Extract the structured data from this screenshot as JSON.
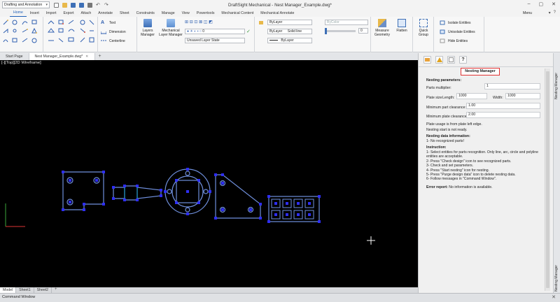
{
  "titlebar": {
    "workspace": "Drafting and Annotation",
    "app_title": "DraftSight Mechanical - Nest Manager_Example.dwg*"
  },
  "menu": {
    "tabs": [
      "Home",
      "Insert",
      "Import",
      "Export",
      "Attach",
      "Annotate",
      "Sheet",
      "Constraints",
      "Manage",
      "View",
      "Powertools",
      "Mechanical Content",
      "Mechanical Annotate"
    ],
    "right_label": "Menu"
  },
  "ribbon": {
    "groups": {
      "quick_group": "Quick Group"
    },
    "annotations": {
      "text": "Text",
      "dimension": "Dimension",
      "centerline": "Centerline"
    },
    "layers": {
      "layers_manager": "Layers Manager",
      "mech_layer_manager": "Mechanical Layer Manager",
      "layer_state": "Unsaved Layer State",
      "current_layer": "0"
    },
    "properties": {
      "color": "ByLayer",
      "linetype": "ByLayer",
      "linetype_desc": "Solid line",
      "lineweight": "ByLayer",
      "plot_style": "ByColor",
      "transparency": "0"
    },
    "tools": {
      "measure": "Measure Geometry",
      "flatten": "Flatten"
    },
    "focus": {
      "isolate": "Isolate Entities",
      "unisolate": "Unisolate Entities",
      "hide": "Hide Entities"
    }
  },
  "doc_tabs": {
    "start": "Start Page",
    "active": "Nest Manager_Example.dwg*"
  },
  "canvas": {
    "view_label": "[-][Top][2D Wireframe]"
  },
  "layout_tabs": [
    "Model",
    "Sheet1",
    "Sheet2"
  ],
  "command_window": "Command Window",
  "panel": {
    "title": "Nesting Manager",
    "params_heading": "Nesting parameters:",
    "parts_multiplier_label": "Parts multiplier:",
    "parts_multiplier": "1",
    "plate_size_label": "Plate size",
    "length_label": "Length:",
    "length": "1000",
    "width_label": "Width:",
    "width": "1000",
    "min_part_clearance_label": "Minimum part clearance:",
    "min_part_clearance": "1.00",
    "min_plate_clearance_label": "Minimum plate clearance:",
    "min_plate_clearance": "2.00",
    "plate_usage": "Plate usage is from plate left edge.",
    "nesting_start": "Nesting start is not ready.",
    "data_heading": "Nesting data information:",
    "data_info": "1- No recognized parts!",
    "instruction_heading": "Instruction:",
    "instructions": [
      "1- Select entities for parts recognition. Only line, arc, circle and polyline entities are acceptable.",
      "2- Press \"Check design\" icon to see recognized parts.",
      "3- Check and set parameters.",
      "4- Press \"Start nesting\" icon for nesting.",
      "5- Press \"Purge design data\" icon to delete nesting data.",
      "6- Follow messages in \"Command Window\"."
    ],
    "error_label": "Error report:",
    "error_text": "No information is available."
  },
  "edge_strip": {
    "top": "Nesting Manager",
    "bottom": "Nesting Manager"
  },
  "colors": {
    "accent": "#1e5fb8",
    "highlight": "#e03131",
    "canvas_bg": "#000000",
    "part_stroke": "#5b7fd6",
    "grip": "#2e2ef5"
  }
}
